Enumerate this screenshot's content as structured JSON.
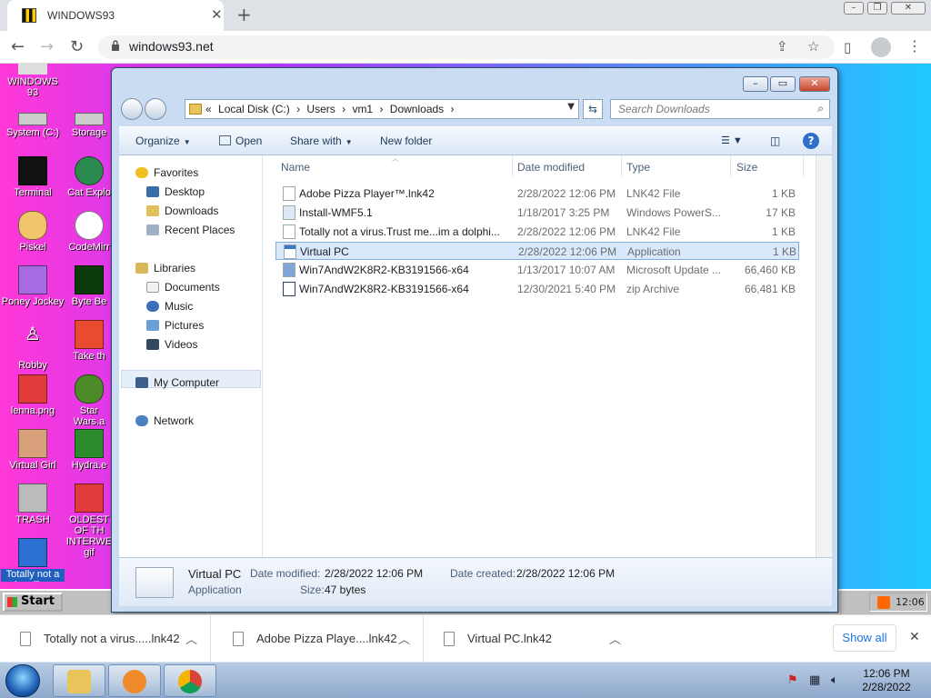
{
  "browser": {
    "tab_title": "WINDOWS93",
    "url": "windows93.net",
    "new_tab": "+",
    "tab_close": "✕"
  },
  "desktop": {
    "icons": [
      {
        "label": "WINDOWS 93"
      },
      {
        "label": "System (C:)"
      },
      {
        "label": "Storage"
      },
      {
        "label": "Terminal"
      },
      {
        "label": "Cat Explo"
      },
      {
        "label": "Piskel"
      },
      {
        "label": "CodeMirr"
      },
      {
        "label": "Poney Jockey"
      },
      {
        "label": "Byte Be"
      },
      {
        "label": "Robby"
      },
      {
        "label": "Take th"
      },
      {
        "label": "lenna.png"
      },
      {
        "label": "Star Wars.a"
      },
      {
        "label": "Virtual Girl"
      },
      {
        "label": "Hydra.e"
      },
      {
        "label": "TRASH"
      },
      {
        "label": "OLDEST OF TH INTERWE gif"
      },
      {
        "label": "Totally not a virus.Trust"
      }
    ],
    "start_label": "Start",
    "tray_time": "12:06"
  },
  "explorer": {
    "breadcrumbs": [
      "«",
      "Local Disk (C:)",
      "›",
      "Users",
      "›",
      "vm1",
      "›",
      "Downloads",
      "›"
    ],
    "search_placeholder": "Search Downloads",
    "commands": {
      "organize": "Organize",
      "open": "Open",
      "share_with": "Share with",
      "new_folder": "New folder"
    },
    "nav": {
      "favorites": "Favorites",
      "desktop": "Desktop",
      "downloads": "Downloads",
      "recent_places": "Recent Places",
      "libraries": "Libraries",
      "documents": "Documents",
      "music": "Music",
      "pictures": "Pictures",
      "videos": "Videos",
      "my_computer": "My Computer",
      "network": "Network"
    },
    "columns": {
      "name": "Name",
      "date": "Date modified",
      "type": "Type",
      "size": "Size"
    },
    "files": [
      {
        "name": "Adobe Pizza Player™.lnk42",
        "date": "2/28/2022 12:06 PM",
        "type": "LNK42 File",
        "size": "1 KB"
      },
      {
        "name": "Install-WMF5.1",
        "date": "1/18/2017 3:25 PM",
        "type": "Windows PowerS...",
        "size": "17 KB"
      },
      {
        "name": "Totally not a virus.Trust me...im a dolphi...",
        "date": "2/28/2022 12:06 PM",
        "type": "LNK42 File",
        "size": "1 KB"
      },
      {
        "name": "Virtual PC",
        "date": "2/28/2022 12:06 PM",
        "type": "Application",
        "size": "1 KB"
      },
      {
        "name": "Win7AndW2K8R2-KB3191566-x64",
        "date": "1/13/2017 10:07 AM",
        "type": "Microsoft Update ...",
        "size": "66,460 KB"
      },
      {
        "name": "Win7AndW2K8R2-KB3191566-x64",
        "date": "12/30/2021 5:40 PM",
        "type": "zip Archive",
        "size": "66,481 KB"
      }
    ],
    "details": {
      "name": "Virtual PC",
      "kind": "Application",
      "modified_label": "Date modified:",
      "modified": "2/28/2022 12:06 PM",
      "created_label": "Date created:",
      "created": "2/28/2022 12:06 PM",
      "size_label": "Size:",
      "size": "47 bytes"
    }
  },
  "downloads": {
    "items": [
      {
        "name": "Totally not a virus.....lnk42"
      },
      {
        "name": "Adobe Pizza Playe....lnk42"
      },
      {
        "name": "Virtual PC.lnk42"
      }
    ],
    "show_all": "Show all"
  },
  "taskbar": {
    "time": "12:06 PM",
    "date": "2/28/2022"
  }
}
